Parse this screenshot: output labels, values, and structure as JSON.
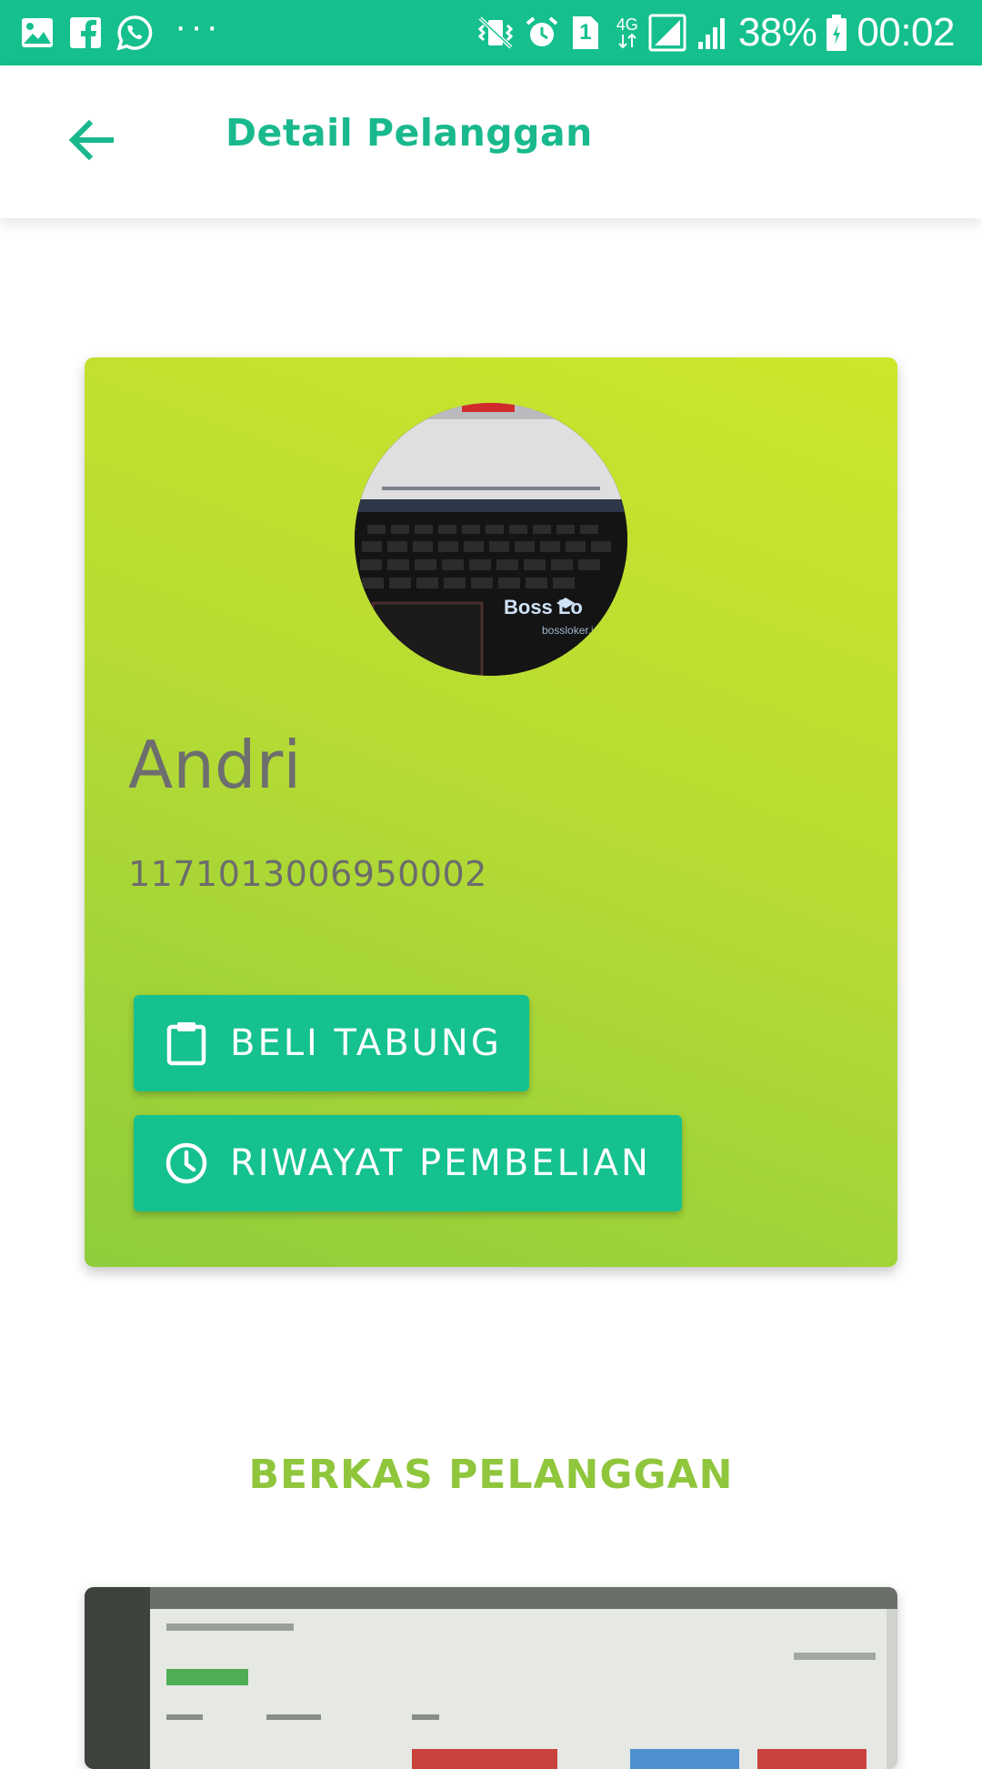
{
  "status_bar": {
    "battery": "38%",
    "time": "00:02",
    "network": "4G",
    "sim": "1",
    "more": "···",
    "icons": [
      "gallery-icon",
      "facebook-icon",
      "whatsapp-icon",
      "vibrate-icon",
      "alarm-icon",
      "sim-icon",
      "network-4g-icon",
      "signal-icon",
      "battery-icon"
    ]
  },
  "app_bar": {
    "title": "Detail Pelanggan",
    "back_icon": "arrow-left-icon"
  },
  "profile": {
    "name": "Andri",
    "id_number": "1171013006950002",
    "photo_text": "Boss Lo",
    "photo_subtext": "bossloker.id"
  },
  "actions": {
    "beli_tabung": "BELI TABUNG",
    "beli_tabung_icon": "clipboard-icon",
    "riwayat_pembelian": "RIWAYAT PEMBELIAN",
    "riwayat_pembelian_icon": "clock-icon"
  },
  "files": {
    "section_title": "BERKAS PELANGGAN"
  },
  "colors": {
    "primary": "#15c08e",
    "accent_green": "#8fc63c",
    "card_gradient_start": "#cde62a",
    "card_gradient_end": "#8fcd3c"
  }
}
